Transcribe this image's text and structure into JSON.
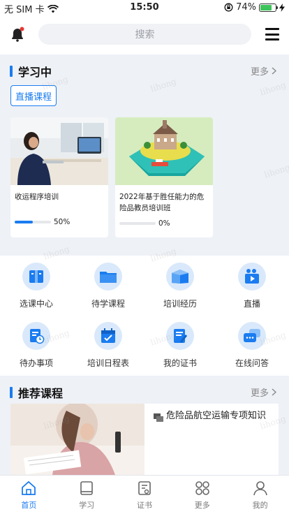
{
  "status_bar": {
    "carrier": "无 SIM 卡",
    "time": "15:50",
    "battery": "74%",
    "battery_level": 0.74
  },
  "header": {
    "search_placeholder": "搜索"
  },
  "learning": {
    "title": "学习中",
    "more": "更多",
    "live_button": "直播课程",
    "courses": [
      {
        "title": "收运程序培训",
        "progress": "50%",
        "progress_value": 0.5
      },
      {
        "title": "2022年基于胜任能力的危险品教员培训班",
        "progress": "0%",
        "progress_value": 0
      }
    ]
  },
  "grid": {
    "items": [
      {
        "label": "选课中心",
        "icon": "book-catalog-icon"
      },
      {
        "label": "待学课程",
        "icon": "folder-icon"
      },
      {
        "label": "培训经历",
        "icon": "open-book-icon"
      },
      {
        "label": "直播",
        "icon": "video-camera-icon"
      },
      {
        "label": "待办事项",
        "icon": "todo-clock-icon"
      },
      {
        "label": "培训日程表",
        "icon": "calendar-icon"
      },
      {
        "label": "我的证书",
        "icon": "certificate-icon"
      },
      {
        "label": "在线问答",
        "icon": "chat-icon"
      }
    ]
  },
  "recommend": {
    "title": "推荐课程",
    "more": "更多",
    "course_title": "危险品航空运输专项知识"
  },
  "tabbar": {
    "tabs": [
      {
        "label": "首页",
        "icon": "home-icon",
        "active": true
      },
      {
        "label": "学习",
        "icon": "book-icon",
        "active": false
      },
      {
        "label": "证书",
        "icon": "certificate-icon",
        "active": false
      },
      {
        "label": "更多",
        "icon": "grid-icon",
        "active": false
      },
      {
        "label": "我的",
        "icon": "user-icon",
        "active": false
      }
    ]
  },
  "watermark": "lihong",
  "colors": {
    "accent": "#1a7cf0",
    "notification": "#e53935",
    "battery": "#3dc55a"
  }
}
